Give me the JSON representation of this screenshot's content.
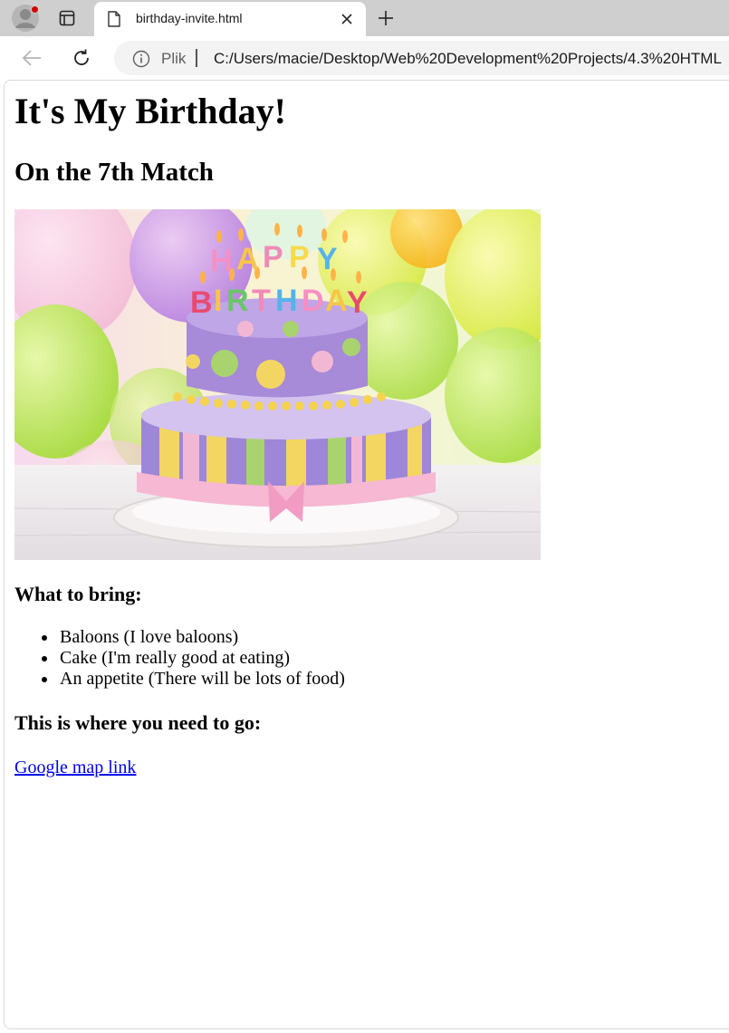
{
  "browser": {
    "tab": {
      "title": "birthday-invite.html"
    },
    "address_bar": {
      "site_label": "Plik",
      "url": "C:/Users/macie/Desktop/Web%20Development%20Projects/4.3%20HTML"
    },
    "colors": {
      "tabbar": "#cfcfcf",
      "omnibox": "#f3f3f3",
      "notification_dot": "#d40000"
    }
  },
  "page": {
    "heading": "It's My Birthday!",
    "subheading": "On the 7th Match",
    "hero_image": {
      "subject": "two-tier purple birthday cake with HAPPY BIRTHDAY candles and colorful balloons"
    },
    "bring_heading": "What to bring:",
    "bring_items": [
      "Baloons (I love baloons)",
      "Cake (I'm really good at eating)",
      "An appetite (There will be lots of food)"
    ],
    "go_heading": "This is where you need to go:",
    "map_link": "Google map link",
    "link_color": "#0000ee"
  }
}
